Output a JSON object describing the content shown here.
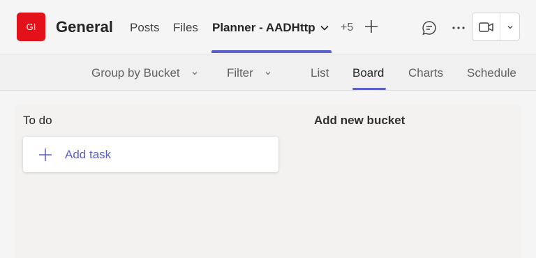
{
  "header": {
    "avatar_initials": "GI",
    "channel_title": "General",
    "tabs": [
      {
        "label": "Posts"
      },
      {
        "label": "Files"
      },
      {
        "label": "Planner - AADHttp"
      }
    ],
    "more_tabs": "+5",
    "icons": [
      "chevron-down-icon",
      "plus-icon",
      "chat-icon",
      "more-icon",
      "video-camera-icon"
    ]
  },
  "toolbar": {
    "group_by": "Group by Bucket",
    "filter": "Filter",
    "views": [
      "List",
      "Board",
      "Charts",
      "Schedule"
    ],
    "active_view": "Board"
  },
  "board": {
    "buckets": [
      {
        "title": "To do"
      }
    ],
    "add_task_label": "Add task",
    "add_bucket_label": "Add new bucket"
  },
  "colors": {
    "avatar": "#e3121a",
    "accent": "#5b5fc7"
  }
}
